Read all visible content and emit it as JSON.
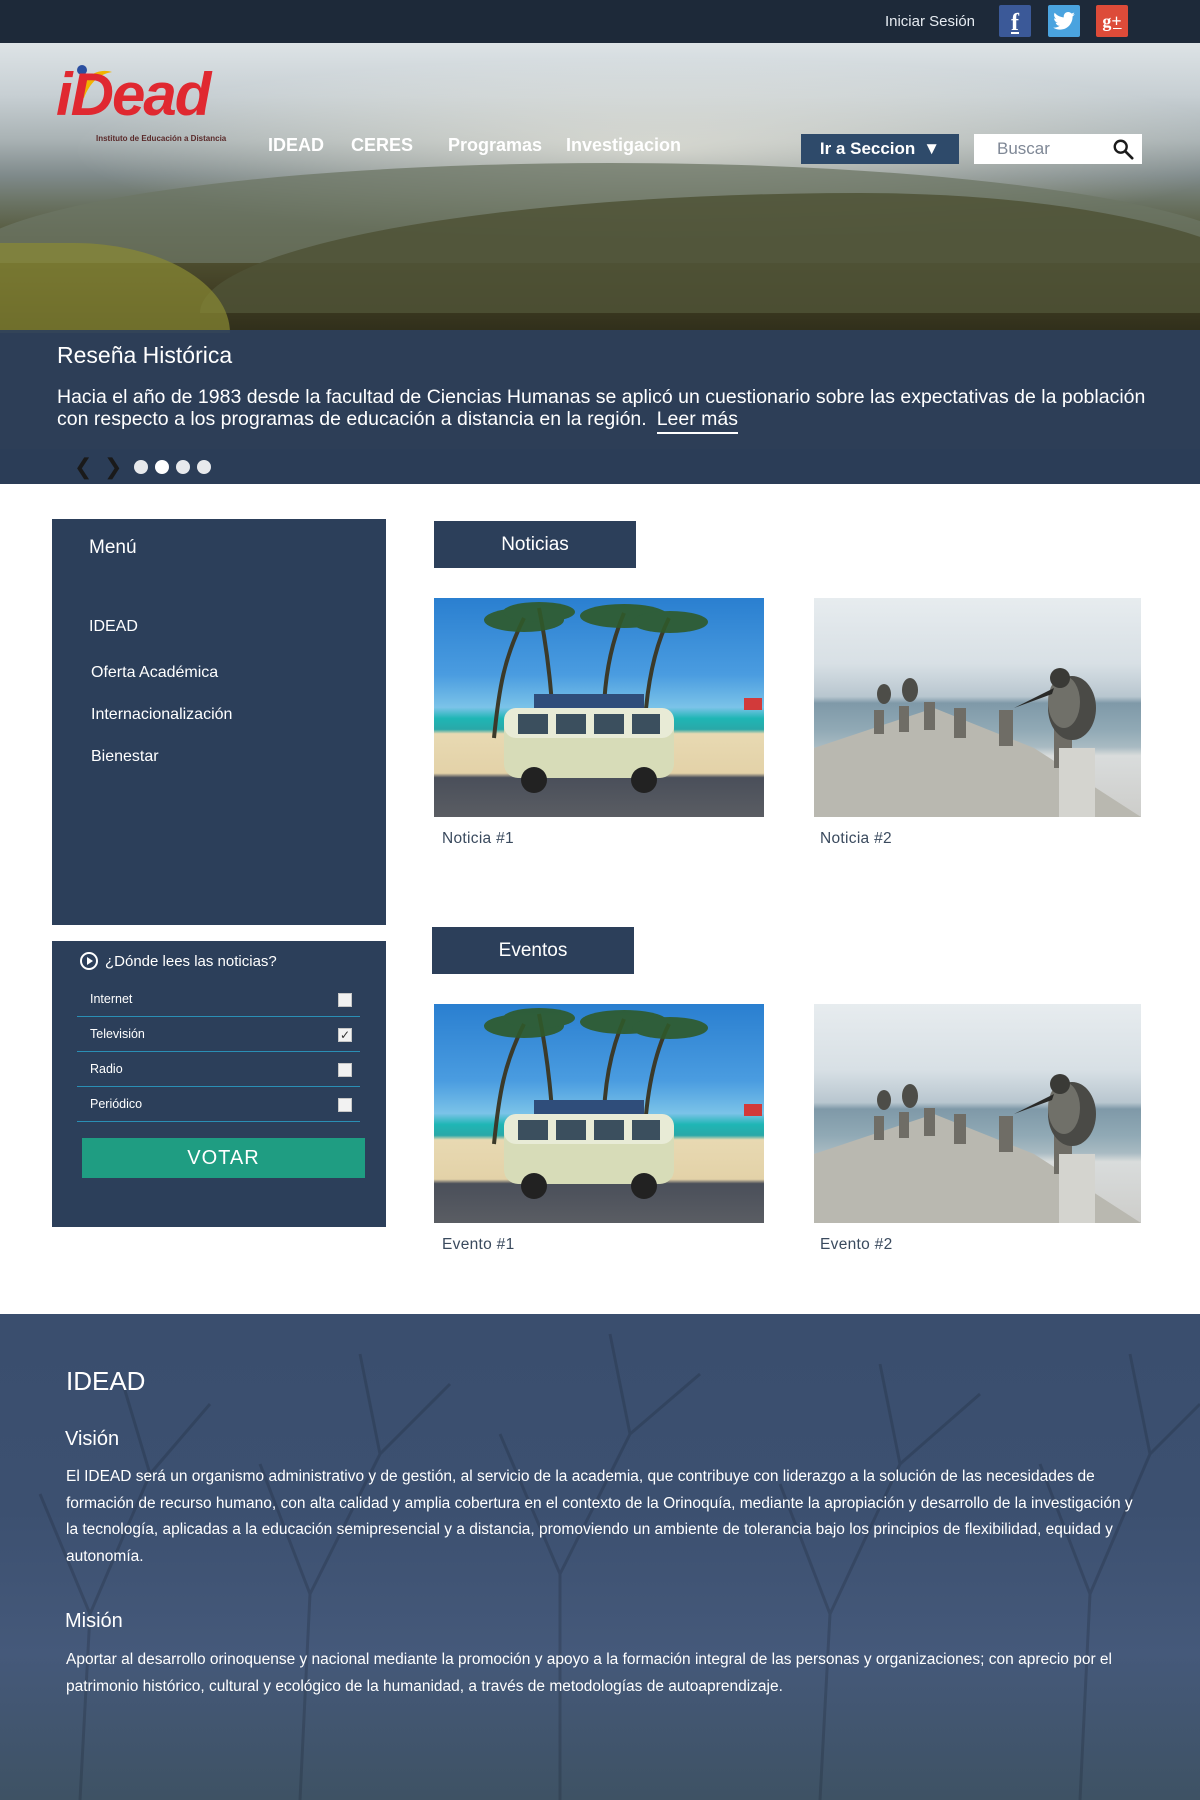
{
  "topbar": {
    "login": "Iniciar Sesión",
    "social": [
      {
        "name": "facebook",
        "glyph": "f",
        "color": "#3b5998"
      },
      {
        "name": "twitter",
        "glyph": "twitter-bird",
        "color": "#4aa3df"
      },
      {
        "name": "google-plus",
        "glyph": "g+",
        "color": "#dd4b39"
      }
    ]
  },
  "header": {
    "logo_text": "iDead",
    "logo_subtitle": "Instituto de Educación a Distancia",
    "nav": [
      "IDEAD",
      "CERES",
      "Programas",
      "Investigacion"
    ],
    "section_button": "Ir a Seccion",
    "search_placeholder": "Buscar"
  },
  "hero": {
    "title": "Reseña Histórica",
    "text": "Hacia el año de 1983 desde la facultad de Ciencias Humanas se aplicó un cuestionario sobre las expectativas de la población con respecto a los programas de educación a distancia en la región.",
    "read_more": "Leer más",
    "slides": 4,
    "active_slide": 2
  },
  "menu": {
    "title": "Menú",
    "items": [
      "IDEAD",
      "Oferta Académica",
      "Internacionalización",
      "Bienestar"
    ]
  },
  "poll": {
    "question": "¿Dónde lees las noticias?",
    "options": [
      {
        "label": "Internet",
        "checked": false
      },
      {
        "label": "Televisión",
        "checked": true
      },
      {
        "label": "Radio",
        "checked": false
      },
      {
        "label": "Periódico",
        "checked": false
      }
    ],
    "vote": "VOTAR"
  },
  "news": {
    "title": "Noticias",
    "items": [
      {
        "caption": "Noticia #1",
        "image": "beach-van"
      },
      {
        "caption": "Noticia #2",
        "image": "pelican-pier"
      }
    ]
  },
  "events": {
    "title": "Eventos",
    "items": [
      {
        "caption": "Evento #1",
        "image": "beach-van"
      },
      {
        "caption": "Evento #2",
        "image": "pelican-pier"
      }
    ]
  },
  "footer": {
    "title": "IDEAD",
    "vision_title": "Visión",
    "vision_text": "El IDEAD será un organismo administrativo y de gestión, al servicio de la academia, que contribuye con liderazgo a la solución de las necesidades de formación de recurso humano, con alta calidad y amplia cobertura en el contexto de la Orinoquía, mediante la apropiación y desarrollo de la investigación y la tecnología, aplicadas a la educación semipresencial y a distancia, promoviendo un ambiente de tolerancia bajo los principios de flexibilidad, equidad y autonomía.",
    "mision_title": "Misión",
    "mision_text": "Aportar al desarrollo orinoquense y nacional mediante la promoción y apoyo a la formación integral de las personas y organizaciones; con aprecio por el patrimonio histórico, cultural y ecológico de la humanidad, a través de metodologías de autoaprendizaje."
  },
  "colors": {
    "topbar": "#1d2939",
    "panel": "#2c3f5a",
    "vote_button": "#1f9d82",
    "logo_red": "#e02830"
  }
}
